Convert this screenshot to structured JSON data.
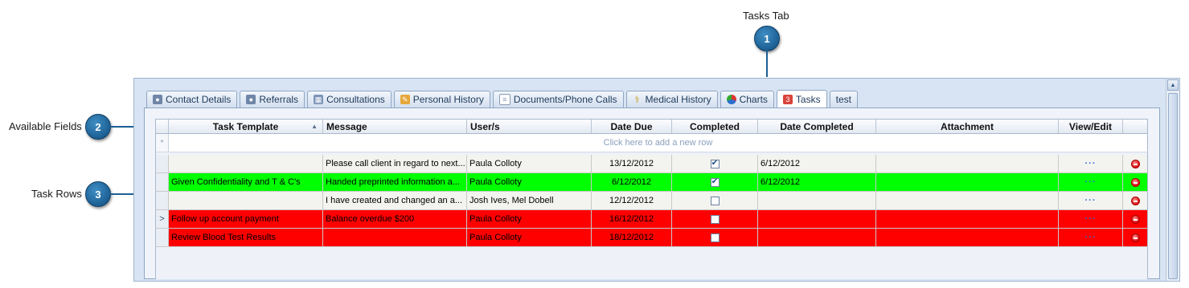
{
  "annotations": {
    "tasks_tab_label": "Tasks Tab",
    "available_fields_label": "Available Fields",
    "task_rows_label": "Task Rows",
    "bubble_1": "1",
    "bubble_2": "2",
    "bubble_3": "3"
  },
  "tabs": [
    {
      "label": "Contact Details",
      "icon": "person-icon"
    },
    {
      "label": "Referrals",
      "icon": "person-icon"
    },
    {
      "label": "Consultations",
      "icon": "calendar-icon"
    },
    {
      "label": "Personal History",
      "icon": "pencil-icon"
    },
    {
      "label": "Documents/Phone Calls",
      "icon": "document-icon"
    },
    {
      "label": "Medical History",
      "icon": "caduceus-icon"
    },
    {
      "label": "Charts",
      "icon": "pie-chart-icon"
    },
    {
      "label": "Tasks",
      "icon": "tasks-badge-icon",
      "badge": "3",
      "active": true
    },
    {
      "label": "test"
    }
  ],
  "grid": {
    "columns": [
      "Task Template",
      "Message",
      "User/s",
      "Date Due",
      "Completed",
      "Date Completed",
      "Attachment",
      "View/Edit"
    ],
    "new_row_text": "Click here to add a new row",
    "new_row_icon": "*",
    "sort_icon": "▲",
    "rows": [
      {
        "template": "",
        "message": "Please call client in regard to next...",
        "users": "Paula Colloty",
        "date_due": "13/12/2012",
        "completed": true,
        "date_completed": "6/12/2012",
        "attachment": "",
        "view_edit": "···",
        "color": "white"
      },
      {
        "template": "Given Confidentiality and T & C's",
        "message": "Handed preprinted information a...",
        "users": "Paula Colloty",
        "date_due": "6/12/2012",
        "completed": true,
        "date_completed": "6/12/2012",
        "attachment": "",
        "view_edit": "···",
        "color": "green"
      },
      {
        "template": "",
        "message": "I have created and changed an a...",
        "users": "Josh Ives, Mel Dobell",
        "date_due": "12/12/2012",
        "completed": false,
        "date_completed": "",
        "attachment": "",
        "view_edit": "···",
        "color": "white"
      },
      {
        "template": "Follow up account payment",
        "message": "Balance overdue $200",
        "users": "Paula Colloty",
        "date_due": "16/12/2012",
        "completed": false,
        "date_completed": "",
        "attachment": "",
        "view_edit": "···",
        "color": "red",
        "current": true
      },
      {
        "template": "Review Blood Test Results",
        "message": "",
        "users": "Paula Colloty",
        "date_due": "18/12/2012",
        "completed": false,
        "date_completed": "",
        "attachment": "",
        "view_edit": "···",
        "color": "red"
      }
    ],
    "current_row_marker": ">",
    "check_mark": "✔"
  },
  "colors": {
    "green_row": "#00ff00",
    "red_row": "#ff0000",
    "accent": "#1c5f94"
  }
}
